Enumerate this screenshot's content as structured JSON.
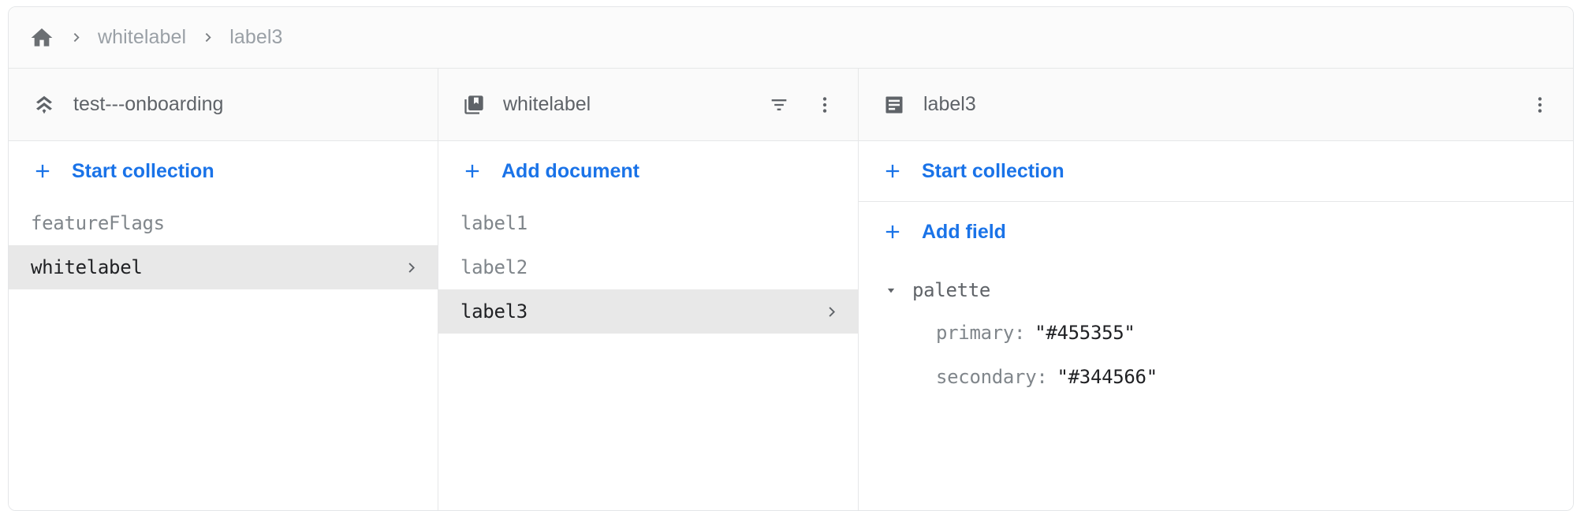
{
  "breadcrumb": {
    "home_icon": "home-icon",
    "separator_icon": "chevron-right-icon",
    "items": [
      {
        "label": "whitelabel"
      },
      {
        "label": "label3"
      }
    ]
  },
  "columns": {
    "database": {
      "header": {
        "icon": "firestore-database-icon",
        "title": "test---onboarding"
      },
      "action": {
        "icon": "plus-icon",
        "label": "Start collection"
      },
      "rows": [
        {
          "label": "featureFlags",
          "selected": false
        },
        {
          "label": "whitelabel",
          "selected": true
        }
      ]
    },
    "collection": {
      "header": {
        "icon": "collections-bookmark-icon",
        "title": "whitelabel",
        "actions": [
          {
            "icon": "filter-list-icon",
            "name": "filter-button"
          },
          {
            "icon": "more-vert-icon",
            "name": "collection-menu-button"
          }
        ]
      },
      "action": {
        "icon": "plus-icon",
        "label": "Add document"
      },
      "rows": [
        {
          "label": "label1",
          "selected": false
        },
        {
          "label": "label2",
          "selected": false
        },
        {
          "label": "label3",
          "selected": true
        }
      ]
    },
    "document": {
      "header": {
        "icon": "document-icon",
        "title": "label3",
        "actions": [
          {
            "icon": "more-vert-icon",
            "name": "document-menu-button"
          }
        ]
      },
      "actions": [
        {
          "icon": "plus-icon",
          "label": "Start collection"
        },
        {
          "icon": "plus-icon",
          "label": "Add field"
        }
      ],
      "fields": [
        {
          "name": "palette",
          "expanded": true,
          "caret_icon": "caret-down-icon",
          "children": [
            {
              "key": "primary",
              "separator": ":",
              "value": "\"#455355\""
            },
            {
              "key": "secondary",
              "separator": ":",
              "value": "\"#344566\""
            }
          ]
        }
      ]
    }
  },
  "colors": {
    "accent": "#1a73e8",
    "selected_row_bg": "#e8e8e8",
    "text_muted": "#80868b",
    "text_strong": "#202124",
    "border": "#e6e7e8"
  }
}
